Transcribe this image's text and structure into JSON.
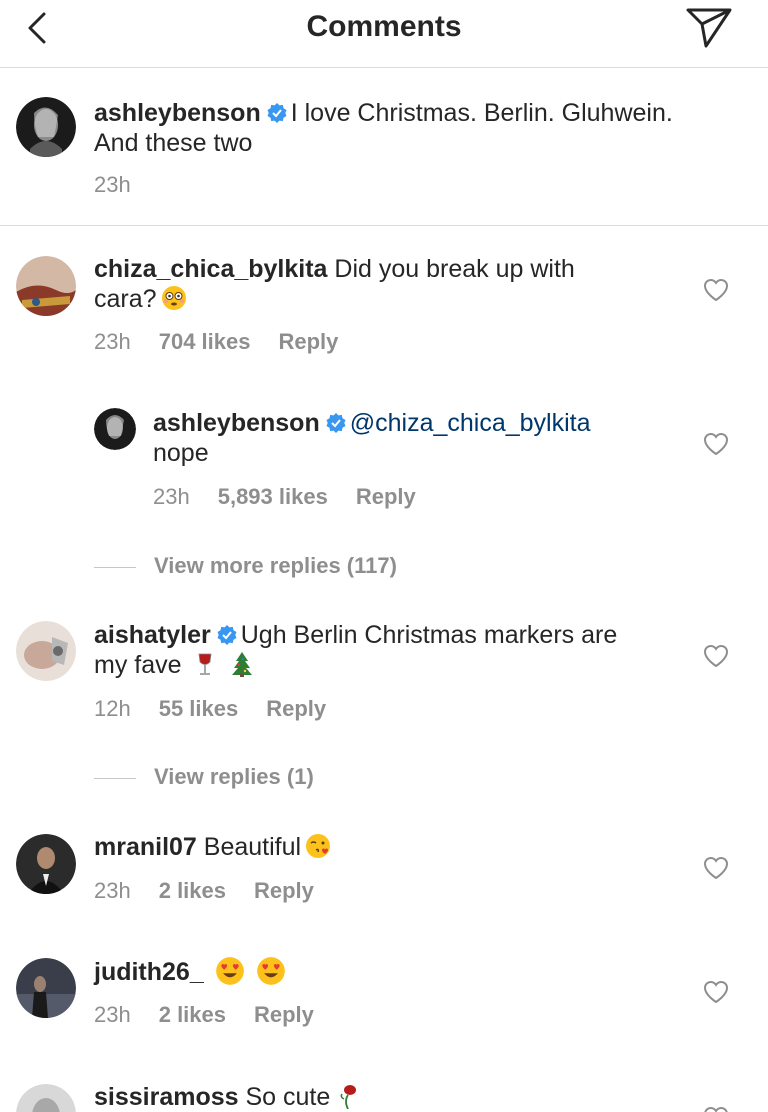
{
  "header": {
    "title": "Comments",
    "back_icon": "chevron-left-icon",
    "send_icon": "paper-plane-icon"
  },
  "caption": {
    "username": "ashleybenson",
    "text_line1": "I love Christmas. Berlin. Gluhwein.",
    "text_line2": "And these two",
    "time": "23h"
  },
  "comments": [
    {
      "username": "chiza_chica_bylkita",
      "text_line1": "Did you break up with",
      "text_line2": "cara?",
      "emoji": "flushed-face",
      "time": "23h",
      "likes": "704 likes",
      "reply": "Reply"
    },
    {
      "username": "ashleybenson",
      "mention": "@chiza_chica_bylkita",
      "text_line2": "nope",
      "time": "23h",
      "likes": "5,893 likes",
      "reply": "Reply"
    },
    {
      "username": "aishatyler",
      "text_line1": "Ugh Berlin Christmas markers are",
      "text_line2": "my fave",
      "time": "12h",
      "likes": "55 likes",
      "reply": "Reply"
    },
    {
      "username": "mranil07",
      "text_line1": "Beautiful",
      "time": "23h",
      "likes": "2 likes",
      "reply": "Reply"
    },
    {
      "username": "judith26_",
      "time": "23h",
      "likes": "2 likes",
      "reply": "Reply"
    },
    {
      "username": "sissiramoss",
      "text_line1": "So cute"
    }
  ],
  "view_more_1": "View more replies (117)",
  "view_more_2": "View replies (1)",
  "colors": {
    "text": "#262626",
    "secondary": "#8e8e8e",
    "mention": "#00376b",
    "verified": "#3897f0",
    "divider": "#dbdbdb"
  }
}
